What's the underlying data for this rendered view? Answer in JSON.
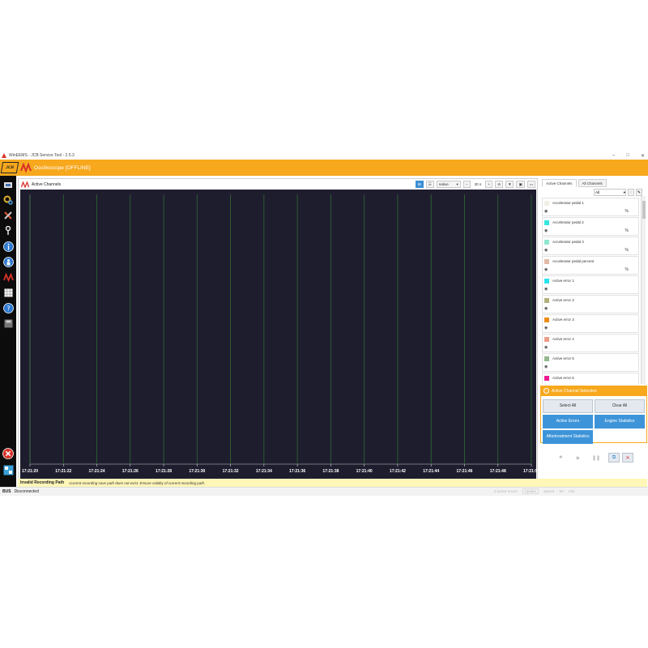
{
  "window": {
    "title": "WinEEMS - JCB Service Tool - 2.5.3",
    "controls": [
      "–",
      "□",
      "✕"
    ]
  },
  "header": {
    "brand": "JCB",
    "title": "Oscilloscope [OFFLINE]"
  },
  "sidebar": {
    "items": [
      "ecu-icon",
      "gears-icon",
      "tools-icon",
      "key-icon",
      "info-icon",
      "info-person-icon",
      "oscilloscope-icon",
      "grid-icon",
      "help-icon",
      "save-icon",
      "close-icon",
      "network-icon"
    ]
  },
  "chart": {
    "title": "Active Channels",
    "toolbar": {
      "mode": "native",
      "window": "30 s",
      "minus": "−",
      "plus": "+"
    },
    "x_ticks": [
      "17:21:20",
      "17:21:22",
      "17:21:24",
      "17:21:26",
      "17:21:28",
      "17:21:30",
      "17:21:32",
      "17:21:34",
      "17:21:36",
      "17:21:38",
      "17:21:40",
      "17:21:42",
      "17:21:44",
      "17:21:46",
      "17:21:48",
      "17:21:50"
    ],
    "colors": {
      "background": "#1e1d2e",
      "gridline": "#2f6b2f",
      "axis": "#ffffff"
    }
  },
  "rightpanel": {
    "tabs": [
      "Active Channels",
      "All Channels"
    ],
    "filter": "All",
    "channels": [
      {
        "name": "Accelerator pedal 1",
        "color": "#f2efe7",
        "unit": "%"
      },
      {
        "name": "Accelerator pedal 2",
        "color": "#35e6e0",
        "unit": "%"
      },
      {
        "name": "Accelerator pedal 3",
        "color": "#8fe8cf",
        "unit": "%"
      },
      {
        "name": "Accelerator pedal percent",
        "color": "#e3b9a6",
        "unit": "%"
      },
      {
        "name": "Active error 1",
        "color": "#29e4f0",
        "unit": ""
      },
      {
        "name": "Active error 2",
        "color": "#b2b07c",
        "unit": ""
      },
      {
        "name": "Active error 3",
        "color": "#ee8c18",
        "unit": ""
      },
      {
        "name": "Active error 4",
        "color": "#ee9d88",
        "unit": ""
      },
      {
        "name": "Active error 5",
        "color": "#93b98d",
        "unit": ""
      },
      {
        "name": "Active error 6",
        "color": "#ec1a92",
        "unit": ""
      }
    ],
    "selection_header": "Active Channel Selection",
    "buttons": {
      "select_all": "Select All",
      "clear_all": "Clear All",
      "active_errors": "Active Errors",
      "engine_statistics": "Engine Statistics",
      "aftertreatment_statistics": "Aftertreatment Statistics"
    }
  },
  "status": {
    "warning_title": "Invalid Recording Path",
    "warning_detail": "Current recording save path does not exist. Ensure validity of current recording path.",
    "bus_label": "BUS",
    "bus_value": "Disconnected",
    "right_items": [
      "0 active errors",
      "Update",
      "Speed",
      "Tel",
      "Info"
    ]
  }
}
